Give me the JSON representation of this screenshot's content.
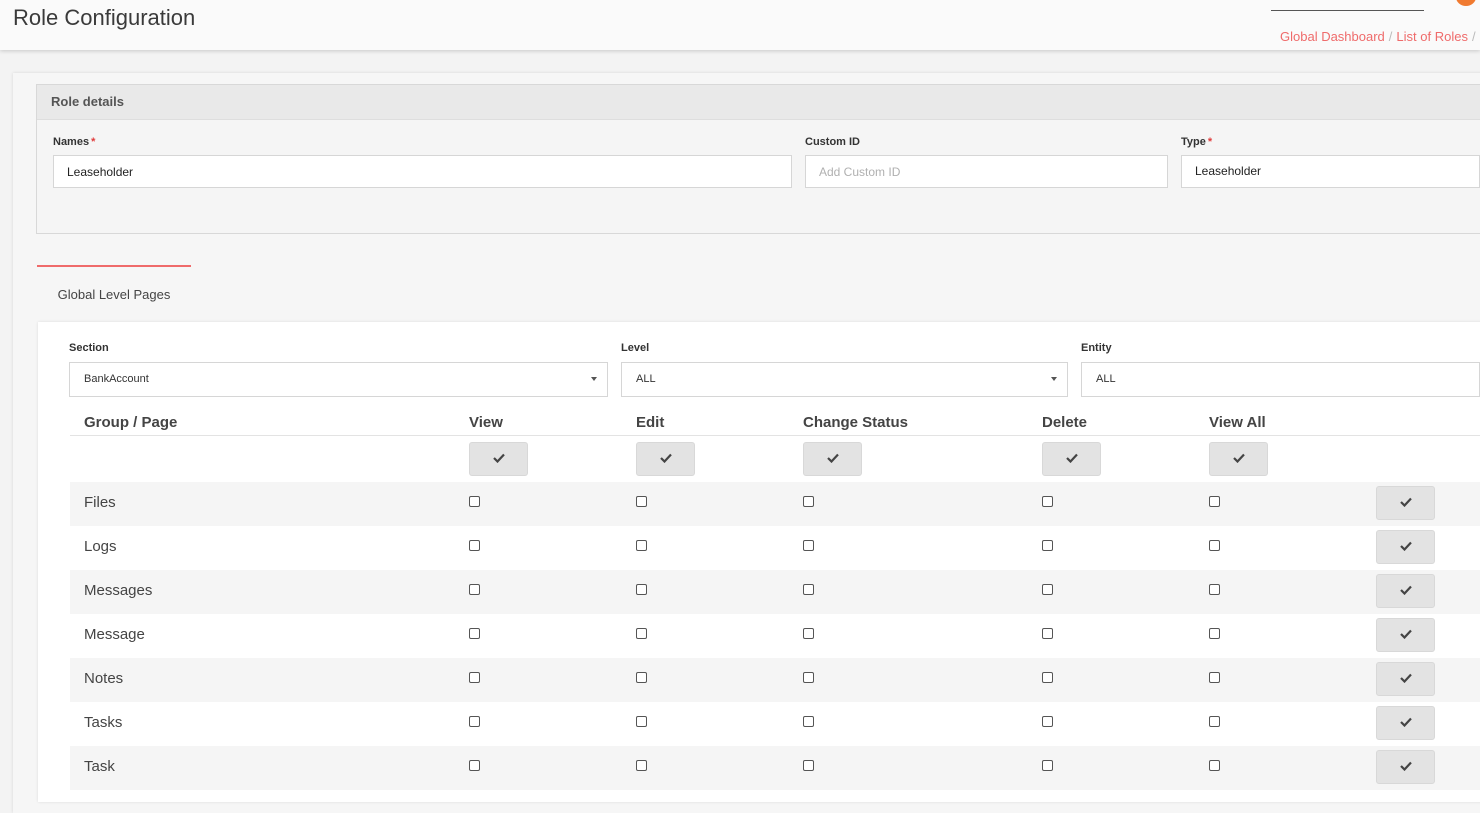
{
  "header": {
    "title": "Role Configuration",
    "breadcrumb": [
      "Global Dashboard",
      "List of Roles"
    ],
    "accent_color": "#ef6b6b"
  },
  "role_details": {
    "heading": "Role details",
    "names_label": "Names",
    "names_value": "Leaseholder",
    "custom_id_label": "Custom ID",
    "custom_id_placeholder": "Add Custom ID",
    "type_label": "Type",
    "type_value": "Leaseholder",
    "required_mark": "*"
  },
  "tabs": [
    {
      "label": "Global Level Pages",
      "active": true
    }
  ],
  "filters": {
    "section_label": "Section",
    "section_value": "BankAccount",
    "level_label": "Level",
    "level_value": "ALL",
    "entity_label": "Entity",
    "entity_value": "ALL"
  },
  "table": {
    "columns": [
      "Group / Page",
      "View",
      "Edit",
      "Change Status",
      "Delete",
      "View All"
    ],
    "rows": [
      {
        "label": "Files",
        "checks": [
          false,
          false,
          false,
          false,
          false
        ]
      },
      {
        "label": "Logs",
        "checks": [
          false,
          false,
          false,
          false,
          false
        ]
      },
      {
        "label": "Messages",
        "checks": [
          false,
          false,
          false,
          false,
          false
        ]
      },
      {
        "label": "Message",
        "checks": [
          false,
          false,
          false,
          false,
          false
        ]
      },
      {
        "label": "Notes",
        "checks": [
          false,
          false,
          false,
          false,
          false
        ]
      },
      {
        "label": "Tasks",
        "checks": [
          false,
          false,
          false,
          false,
          false
        ]
      },
      {
        "label": "Task",
        "checks": [
          false,
          false,
          false,
          false,
          false
        ]
      }
    ]
  }
}
